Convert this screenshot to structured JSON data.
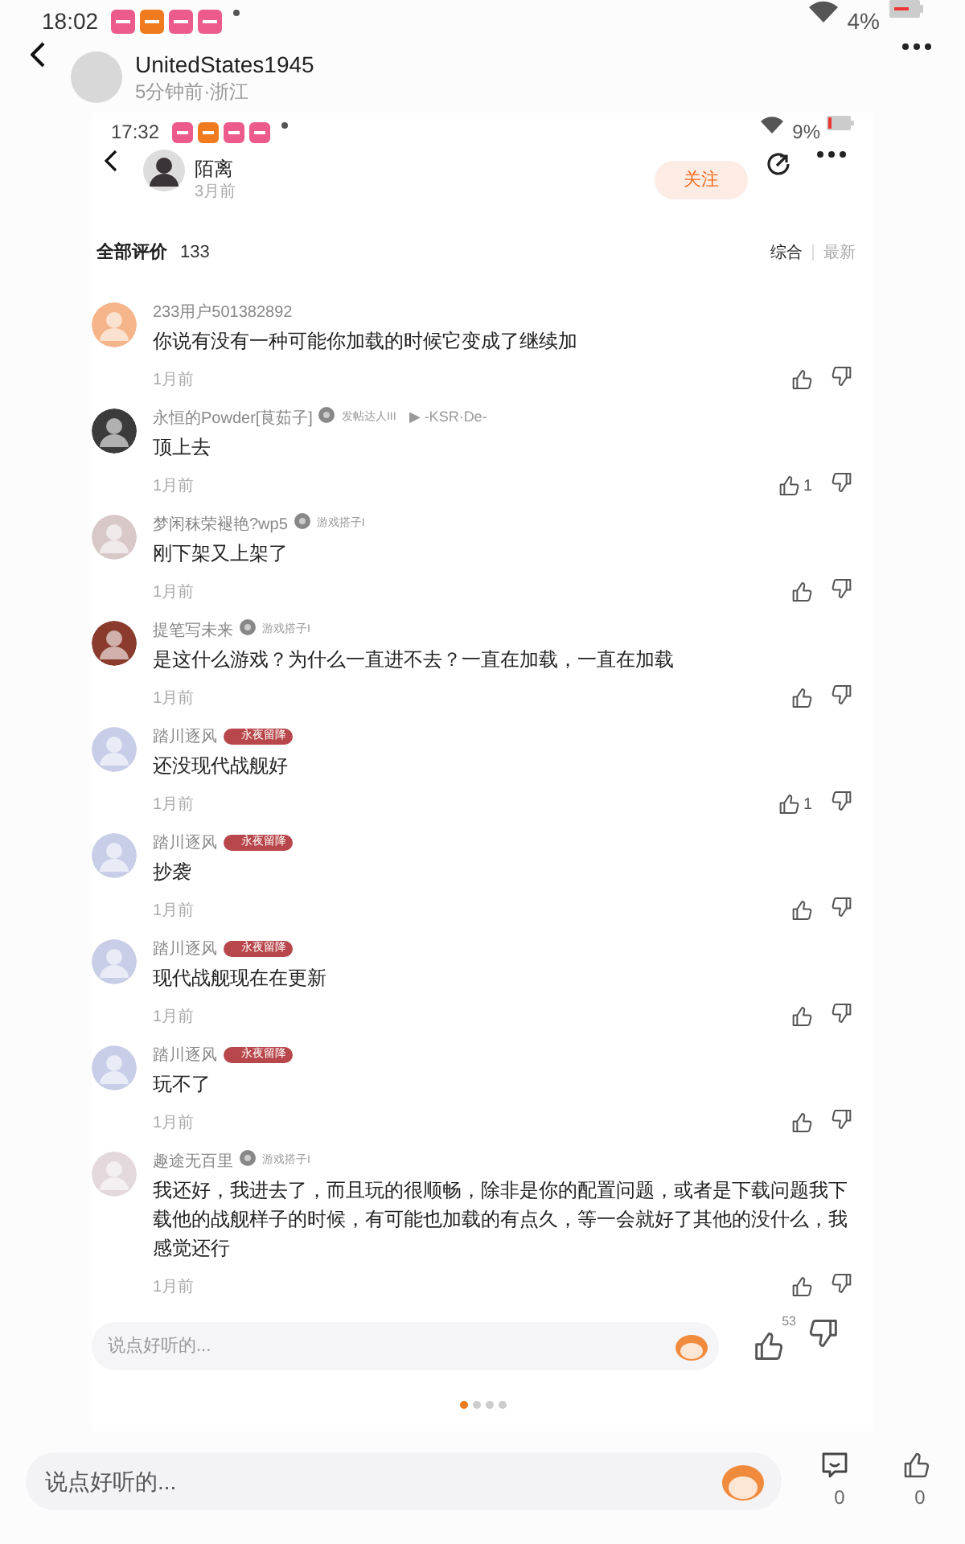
{
  "status_bar": {
    "time": "18:02",
    "battery": "4%"
  },
  "post_header": {
    "author": "UnitedStates1945",
    "meta": "5分钟前·浙江"
  },
  "screenshot": {
    "status_bar": {
      "time": "17:32",
      "battery": "9%"
    },
    "header": {
      "name": "陌离",
      "time": "3月前",
      "follow": "关注"
    },
    "comments_header": {
      "title": "全部评价",
      "count": "133",
      "sort_tabs": [
        {
          "label": "综合",
          "selected": true
        },
        {
          "label": "最新",
          "selected": false
        }
      ]
    },
    "comments": [
      {
        "user": "233用户501382892",
        "text": "你说有没有一种可能你加载的时候它变成了继续加",
        "time": "1月前"
      },
      {
        "user": "永恒的Powder[茛茹子]",
        "badges": [
          {
            "kind": "level",
            "label": "发帖达人III"
          },
          {
            "kind": "link",
            "label": "▶ -KSR·De-"
          }
        ],
        "text": "顶上去",
        "time": "1月前",
        "likes": "1"
      },
      {
        "user": "梦闲秣荣褪艳?wp5",
        "badges": [
          {
            "kind": "level",
            "label": "游戏搭子I"
          }
        ],
        "text": "刚下架又上架了",
        "time": "1月前"
      },
      {
        "user": "提笔写未来",
        "badges": [
          {
            "kind": "level",
            "label": "游戏搭子I"
          }
        ],
        "text": "是这什么游戏？为什么一直进不去？一直在加载，一直在加载",
        "time": "1月前"
      },
      {
        "user": "踏川逐风",
        "badges": [
          {
            "kind": "tag",
            "label": "永夜留降"
          }
        ],
        "text": "还没现代战舰好",
        "time": "1月前",
        "likes": "1"
      },
      {
        "user": "踏川逐风",
        "badges": [
          {
            "kind": "tag",
            "label": "永夜留降"
          }
        ],
        "text": "抄袭",
        "time": "1月前"
      },
      {
        "user": "踏川逐风",
        "badges": [
          {
            "kind": "tag",
            "label": "永夜留降"
          }
        ],
        "text": "现代战舰现在在更新",
        "time": "1月前"
      },
      {
        "user": "踏川逐风",
        "badges": [
          {
            "kind": "tag",
            "label": "永夜留降"
          }
        ],
        "text": "玩不了",
        "time": "1月前"
      },
      {
        "user": "趣途无百里",
        "badges": [
          {
            "kind": "level",
            "label": "游戏搭子I"
          }
        ],
        "text": "我还好，我进去了，而且玩的很顺畅，除非是你的配置问题，或者是下载问题我下载他的战舰样子的时候，有可能也加载的有点久，等一会就好了其他的没什么，我感觉还行",
        "time": "1月前"
      }
    ],
    "comment_bar": {
      "placeholder": "说点好听的...",
      "like_count": "53"
    },
    "pager": [
      {
        "selected": true
      },
      {
        "selected": false
      },
      {
        "selected": false
      },
      {
        "selected": false
      }
    ]
  },
  "bottom_bar": {
    "placeholder": "说点好听的...",
    "comment_count": "0",
    "like_count": "0"
  }
}
